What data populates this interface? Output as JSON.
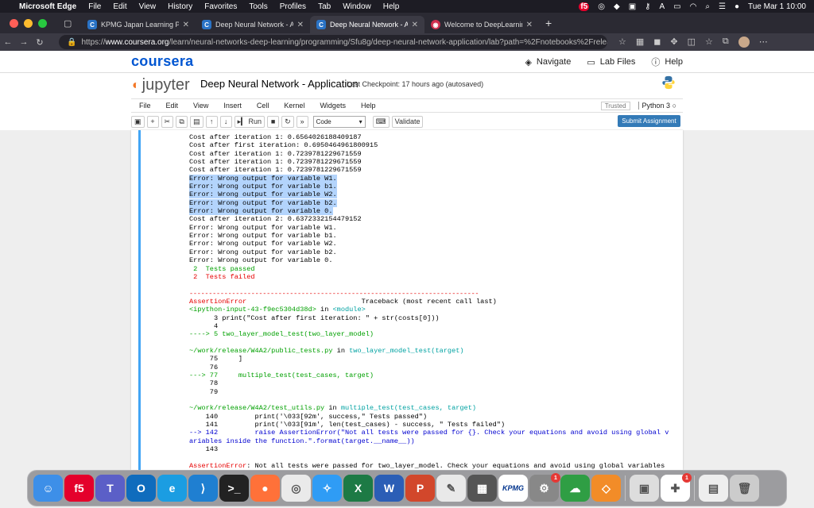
{
  "menubar": {
    "app": "Microsoft Edge",
    "items": [
      "File",
      "Edit",
      "View",
      "History",
      "Favorites",
      "Tools",
      "Profiles",
      "Tab",
      "Window",
      "Help"
    ],
    "clock": "Tue Mar 1  10:00",
    "f5": "f5"
  },
  "tabs": [
    {
      "title": "KPMG Japan Learning Program",
      "fav": "C"
    },
    {
      "title": "Deep Neural Network - Application",
      "fav": "C"
    },
    {
      "title": "Deep Neural Network - Application",
      "fav": "C",
      "active": true
    },
    {
      "title": "Welcome to DeepLearning.AI",
      "fav": "◉"
    }
  ],
  "address": {
    "prefix": "https://",
    "domain": "www.coursera.org",
    "path": "/learn/neural-networks-deep-learning/programming/Sfu8g/deep-neural-network-application/lab?path=%2Fnotebooks%2Frelease%2FW4A2%..."
  },
  "coursera": {
    "logo": "coursera",
    "navigate": "Navigate",
    "lab_files": "Lab Files",
    "help": "Help"
  },
  "jupyter": {
    "logo": "jupyter",
    "title": "Deep Neural Network - Application",
    "checkpoint": "Last Checkpoint: 17 hours ago",
    "autosaved": "(autosaved)",
    "menu": [
      "File",
      "Edit",
      "View",
      "Insert",
      "Cell",
      "Kernel",
      "Widgets",
      "Help"
    ],
    "trusted": "Trusted",
    "kernel": "Python 3",
    "run": "Run",
    "cell_type": "Code",
    "validate": "Validate",
    "submit": "Submit Assignment"
  },
  "output": {
    "lines_pre": [
      "Cost after iteration 1: 0.6564026188409187",
      "Cost after first iteration: 0.6950464961800915",
      "Cost after iteration 1: 0.7239781229671559",
      "Cost after iteration 1: 0.7239781229671559",
      "Cost after iteration 1: 0.7239781229671559"
    ],
    "highlighted": [
      "Error: Wrong output for variable W1.",
      "Error: Wrong output for variable b1.",
      "Error: Wrong output for variable W2.",
      "Error: Wrong output for variable b2.",
      "Error: Wrong output for variable 0."
    ],
    "lines_mid": [
      "Cost after iteration 2: 0.6372332154479152",
      "Error: Wrong output for variable W1.",
      "Error: Wrong output for variable b1.",
      "Error: Wrong output for variable W2.",
      "Error: Wrong output for variable b2.",
      "Error: Wrong output for variable 0."
    ],
    "passed": " 2  Tests passed",
    "failed": " 2  Tests failed",
    "dashes": "---------------------------------------------------------------------------",
    "assert_name": "AssertionError",
    "traceback": "                            Traceback (most recent call last)",
    "ipy_input": "<ipython-input-43-f9ec5304d38d>",
    "in": " in ",
    "module": "<module>",
    "l3": "      3 print(\"Cost after first iteration: \" + str(costs[0]))",
    "l4": "      4",
    "l5arrow": "----> 5 two_layer_model_test(two_layer_model)",
    "file1": "~/work/release/W4A2/public_tests.py",
    "func1": "two_layer_model_test(target)",
    "l75": "     75     ]",
    "l76": "     76",
    "l77": "---> 77     multiple_test(test_cases, target)",
    "l78": "     78",
    "l79": "     79",
    "file2": "~/work/release/W4A2/test_utils.py",
    "func2": "multiple_test(test_cases, target)",
    "l140": "    140         print('\\033[92m', success,\" Tests passed\")",
    "l141": "    141         print('\\033[91m', len(test_cases) - success, \" Tests failed\")",
    "l142": "--> 142         raise AssertionError(\"Not all tests were passed for {}. Check your equations and avoid using global v",
    "l142b": "ariables inside the function.\".format(target.__name__))",
    "l143": "    143",
    "final": ": Not all tests were passed for two_layer_model. Check your equations and avoid using global variables"
  },
  "dock": {
    "apps": [
      {
        "name": "finder",
        "glyph": "☺",
        "color": "#3d8fe8"
      },
      {
        "name": "f5",
        "glyph": "f5",
        "color": "#e4002b"
      },
      {
        "name": "teams",
        "glyph": "T",
        "color": "#5b5fc7"
      },
      {
        "name": "outlook",
        "glyph": "O",
        "color": "#0f6cbd"
      },
      {
        "name": "edge",
        "glyph": "e",
        "color": "#1b9de2"
      },
      {
        "name": "vscode",
        "glyph": "⟩",
        "color": "#1f7fd1"
      },
      {
        "name": "terminal",
        "glyph": ">_",
        "color": "#222"
      },
      {
        "name": "firefox",
        "glyph": "●",
        "color": "#ff7139"
      },
      {
        "name": "chrome",
        "glyph": "◎",
        "color": "#eaeaea"
      },
      {
        "name": "safari",
        "glyph": "✧",
        "color": "#2f9cf5"
      },
      {
        "name": "excel",
        "glyph": "X",
        "color": "#1d7a45"
      },
      {
        "name": "word",
        "glyph": "W",
        "color": "#2b5eb6"
      },
      {
        "name": "powerpoint",
        "glyph": "P",
        "color": "#d2472b"
      },
      {
        "name": "textedit",
        "glyph": "✎",
        "color": "#e9e9e9"
      },
      {
        "name": "calculator",
        "glyph": "▦",
        "color": "#555"
      },
      {
        "name": "kpmg",
        "glyph": "KPMG",
        "color": "#ffffff"
      },
      {
        "name": "settings",
        "glyph": "⚙",
        "color": "#888",
        "badge": "1"
      },
      {
        "name": "remote",
        "glyph": "☁",
        "color": "#2f9e44"
      },
      {
        "name": "network",
        "glyph": "◇",
        "color": "#f28c28"
      },
      {
        "name": "preview",
        "glyph": "▣",
        "color": "#ddd"
      },
      {
        "name": "appstore",
        "glyph": "✚",
        "color": "#fff",
        "badge": "1"
      },
      {
        "name": "downloads",
        "glyph": "▤",
        "color": "#eee"
      },
      {
        "name": "trash",
        "glyph": "🗑",
        "color": "#ccc"
      }
    ]
  }
}
